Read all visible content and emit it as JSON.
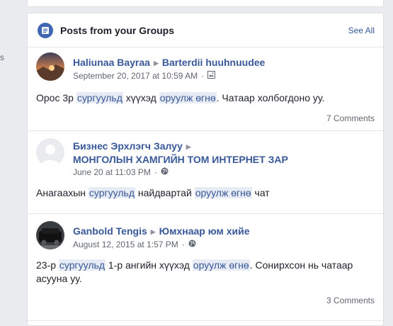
{
  "left": {
    "fragment": "s"
  },
  "header": {
    "title": "Posts from your Groups",
    "see_all": "See All",
    "icon": "news-feed-icon"
  },
  "posts": [
    {
      "author": "Haliunaa Bayraa",
      "group": "Barterdii huuhnuudee",
      "time": "September 20, 2017 at 10:59 AM",
      "privacy_icon": "image-icon",
      "text": [
        "Орос 3р ",
        "сургуульд",
        " хүүхэд ",
        "оруулж өгнө",
        ". Чатаар холбогдоно уу."
      ],
      "comments": "7 Comments"
    },
    {
      "author": "Бизнес Эрхлэгч Залуу",
      "group": "МОНГОЛЫН ХАМГИЙН ТОМ ИНТЕРНЕТ ЗАР",
      "time": "June 20 at 11:03 PM",
      "privacy_icon": "globe-icon",
      "text": [
        "Анагаахын ",
        "сургуульд",
        " найдвартай ",
        "оруулж өгнө",
        " чат"
      ]
    },
    {
      "author": "Ganbold Tengis",
      "group": "Юмхнаар юм хийе",
      "time": "August 12, 2015 at 1:57 PM",
      "privacy_icon": "globe-icon",
      "text": [
        "23-р ",
        "сургуульд",
        " 1-р ангийн хүүхэд ",
        "оруулж өгнө",
        ". Сонирхсон нь чатаар асууна уу."
      ],
      "comments": "3 Comments"
    }
  ],
  "colors": {
    "link": "#385898",
    "highlight_bg": "#e7ebf3",
    "page_bg": "#e9ebee",
    "icon_blue": "#4267b2"
  }
}
